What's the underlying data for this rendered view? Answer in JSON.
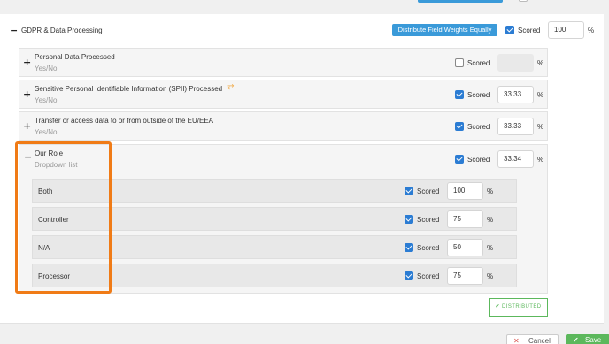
{
  "group": {
    "title": "GDPR & Data Processing",
    "distribute_label": "Distribute Field Weights Equally",
    "scored_label": "Scored",
    "weight": "100",
    "pct": "%"
  },
  "fields": [
    {
      "title": "Personal Data Processed",
      "type": "Yes/No",
      "scored": false,
      "scored_label": "Scored",
      "weight": "",
      "pct": "%"
    },
    {
      "title": "Sensitive Personal Identifiable Information (SPII) Processed",
      "type": "Yes/No",
      "scored": true,
      "scored_label": "Scored",
      "weight": "33.33",
      "pct": "%"
    },
    {
      "title": "Transfer or access data to or from outside of the EU/EEA",
      "type": "Yes/No",
      "scored": true,
      "scored_label": "Scored",
      "weight": "33.33",
      "pct": "%"
    },
    {
      "title": "Our Role",
      "type": "Dropdown list",
      "scored": true,
      "scored_label": "Scored",
      "weight": "33.34",
      "pct": "%"
    }
  ],
  "options": [
    {
      "label": "Both",
      "scored_label": "Scored",
      "weight": "100",
      "pct": "%"
    },
    {
      "label": "Controller",
      "scored_label": "Scored",
      "weight": "75",
      "pct": "%"
    },
    {
      "label": "N/A",
      "scored_label": "Scored",
      "weight": "50",
      "pct": "%"
    },
    {
      "label": "Processor",
      "scored_label": "Scored",
      "weight": "75",
      "pct": "%"
    }
  ],
  "distributed_label": "DISTRIBUTED",
  "footer": {
    "cancel_label": "Cancel",
    "save_label": "Save"
  },
  "colors": {
    "accent": "#3a9ad9",
    "checkbox": "#2b7cd3",
    "highlight": "#f07b16",
    "success": "#5cb85c"
  }
}
